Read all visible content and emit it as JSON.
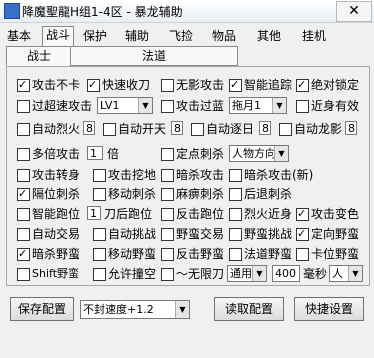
{
  "window": {
    "title": "降魔聖龍H组1-4区 - 暴龙辅助",
    "close": "✕"
  },
  "tabs": [
    "基本",
    "战斗",
    "保护",
    "辅助",
    "飞捡",
    "物品",
    "其他",
    "挂机"
  ],
  "active_tab": "战斗",
  "subtabs": [
    "战士",
    "法道"
  ],
  "options": {
    "r1": [
      {
        "label": "攻击不卡",
        "checked": true
      },
      {
        "label": "快速收刀",
        "checked": true
      },
      {
        "label": "无影攻击",
        "checked": false
      },
      {
        "label": "智能追踪",
        "checked": true
      },
      {
        "label": "绝对锁定",
        "checked": true
      }
    ],
    "r2": {
      "a": {
        "label": "过超速攻击",
        "checked": false
      },
      "a_select": "LV1",
      "b": {
        "label": "攻击过蓝",
        "checked": false
      },
      "b_select": "拖月1",
      "c": {
        "label": "近身有效",
        "checked": false
      }
    },
    "r3": [
      {
        "label": "自动烈火",
        "checked": false,
        "value": "8"
      },
      {
        "label": "自动开天",
        "checked": false,
        "value": "8"
      },
      {
        "label": "自动逐日",
        "checked": false,
        "value": "8"
      },
      {
        "label": "自动龙影",
        "checked": false,
        "value": "8"
      }
    ],
    "r4": {
      "a": {
        "label": "多倍攻击",
        "checked": false,
        "value": "1",
        "suffix": "倍"
      },
      "b": {
        "label": "定点刺杀",
        "checked": false
      },
      "b_select": "人物方向"
    },
    "r5": [
      {
        "label": "攻击转身",
        "checked": false
      },
      {
        "label": "攻击挖地",
        "checked": false
      },
      {
        "label": "暗杀攻击",
        "checked": false
      },
      {
        "label": "暗杀攻击(新)",
        "checked": false
      }
    ],
    "r6": [
      {
        "label": "隔位刺杀",
        "checked": true
      },
      {
        "label": "移动刺杀",
        "checked": false
      },
      {
        "label": "麻痹刺杀",
        "checked": false
      },
      {
        "label": "后退刺杀",
        "checked": false
      }
    ],
    "r7": {
      "a": {
        "label": "智能跑位",
        "checked": false,
        "value": "1",
        "suffix": "刀后跑位"
      },
      "b": {
        "label": "反击跑位",
        "checked": false
      },
      "c": {
        "label": "烈火近身",
        "checked": false
      },
      "d": {
        "label": "攻击变色",
        "checked": true
      }
    },
    "r8": [
      {
        "label": "自动交易",
        "checked": false
      },
      {
        "label": "自动挑战",
        "checked": false
      },
      {
        "label": "野蛮交易",
        "checked": false
      },
      {
        "label": "野蛮挑战",
        "checked": false
      },
      {
        "label": "定向野蛮",
        "checked": true
      }
    ],
    "r9": [
      {
        "label": "暗杀野蛮",
        "checked": true
      },
      {
        "label": "移动野蛮",
        "checked": false
      },
      {
        "label": "反击野蛮",
        "checked": false
      },
      {
        "label": "法道野蛮",
        "checked": false
      },
      {
        "label": "卡位野蛮",
        "checked": false
      }
    ],
    "r10": {
      "a": {
        "label": "Shift野蛮",
        "checked": false
      },
      "b": {
        "label": "允许撞空",
        "checked": false
      },
      "c": {
        "label": "～无限刀",
        "checked": false
      },
      "c_select": "通用",
      "value": "400",
      "suffix": "毫秒",
      "d_select": "人"
    }
  },
  "footer": {
    "save_label": "保存配置",
    "speed_select": "不封速度+1.2",
    "load_label": "读取配置",
    "quick_label": "快捷设置"
  }
}
